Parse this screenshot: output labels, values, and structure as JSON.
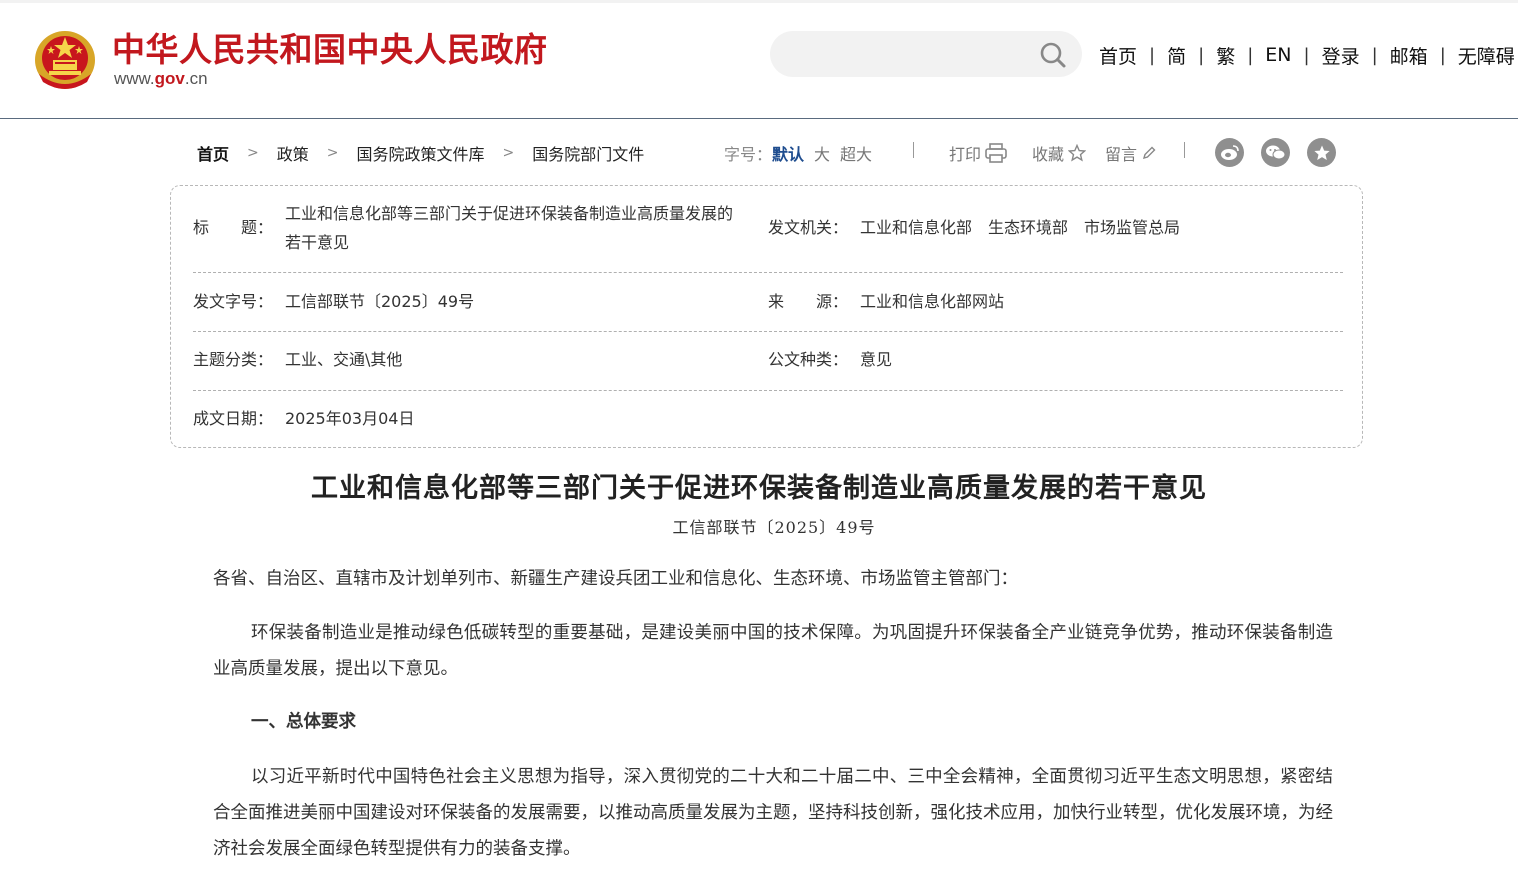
{
  "header": {
    "site_title": "中华人民共和国中央人民政府",
    "site_url_prefix": "www.",
    "site_url_highlight": "gov",
    "site_url_suffix": ".cn",
    "search_placeholder": "",
    "nav": [
      "首页",
      "简",
      "繁",
      "EN",
      "登录",
      "邮箱",
      "无障碍"
    ],
    "brand_color": "#c2181e"
  },
  "breadcrumb": [
    "首页",
    "政策",
    "国务院政策文件库",
    "国务院部门文件"
  ],
  "font_size": {
    "label": "字号：",
    "options": [
      "默认",
      "大",
      "超大"
    ],
    "selected": "默认"
  },
  "tools": {
    "print": "打印",
    "favorite": "收藏",
    "comment": "留言"
  },
  "share_icons": [
    "weibo-icon",
    "wechat-icon",
    "star-icon"
  ],
  "info": {
    "title_label": "标　　题：",
    "title_value_line1": "工业和信息化部等三部门关于促进环保装备制造业高质量发展的",
    "title_value_line2": "若干意见",
    "issuer_label": "发文机关：",
    "issuer_value": "工业和信息化部　生态环境部　市场监管总局",
    "doc_no_label": "发文字号：",
    "doc_no_value": "工信部联节〔2025〕49号",
    "source_label": "来　　源：",
    "source_value": "工业和信息化部网站",
    "topic_label": "主题分类：",
    "topic_value": "工业、交通\\其他",
    "type_label": "公文种类：",
    "type_value": "意见",
    "date_label": "成文日期：",
    "date_value": "2025年03月04日"
  },
  "article": {
    "title": "工业和信息化部等三部门关于促进环保装备制造业高质量发展的若干意见",
    "doc_number": "工信部联节〔2025〕49号",
    "salutation": "各省、自治区、直辖市及计划单列市、新疆生产建设兵团工业和信息化、生态环境、市场监管主管部门：",
    "intro": "环保装备制造业是推动绿色低碳转型的重要基础，是建设美丽中国的技术保障。为巩固提升环保装备全产业链竞争优势，推动环保装备制造业高质量发展，提出以下意见。",
    "section1_heading": "一、总体要求",
    "section1_para": "以习近平新时代中国特色社会主义思想为指导，深入贯彻党的二十大和二十届二中、三中全会精神，全面贯彻习近平生态文明思想，紧密结合全面推进美丽中国建设对环保装备的发展需要，以推动高质量发展为主题，坚持科技创新，强化技术应用，加快行业转型，优化发展环境，为经济社会发展全面绿色转型提供有力的装备支撑。"
  }
}
